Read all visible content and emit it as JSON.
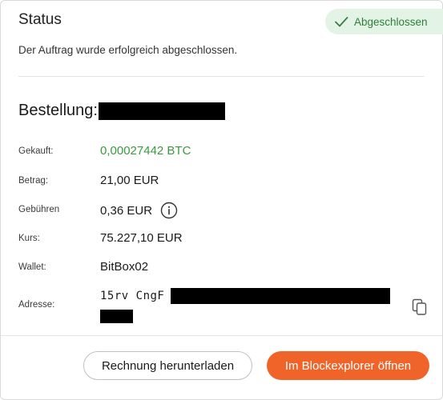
{
  "header": {
    "title": "Status",
    "badge_label": "Abgeschlossen",
    "subtitle": "Der Auftrag wurde erfolgreich abgeschlossen."
  },
  "order": {
    "title": "Bestellung:"
  },
  "details": {
    "bought_label": "Gekauft:",
    "bought_value": "0,00027442 BTC",
    "amount_label": "Betrag:",
    "amount_value": "21,00 EUR",
    "fees_label": "Gebühren",
    "fees_value": "0,36 EUR",
    "rate_label": "Kurs:",
    "rate_value": "75.227,10 EUR",
    "wallet_label": "Wallet:",
    "wallet_value": "BitBox02",
    "address_label": "Adresse:",
    "address_value": "15rv CngF"
  },
  "actions": {
    "download_invoice": "Rechnung herunterladen",
    "open_explorer": "Im Blockexplorer öffnen"
  },
  "colors": {
    "accent": "#f06429",
    "success": "#3a9a3f",
    "badge_bg": "#e3f4e6"
  },
  "icons": {
    "badge": "checkmark-icon",
    "fees": "info-icon",
    "address": "copy-icon"
  }
}
